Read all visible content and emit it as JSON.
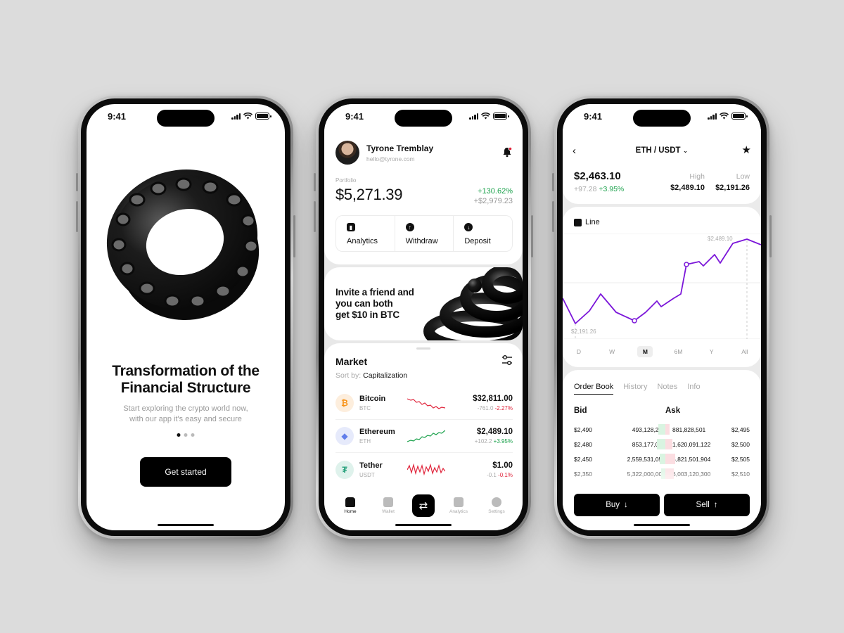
{
  "status_time": "9:41",
  "onboarding": {
    "title_line1": "Transformation of the",
    "title_line2": "Financial Structure",
    "subtitle_line1": "Start exploring the crypto world now,",
    "subtitle_line2": "with our app it's easy and secure",
    "cta_label": "Get started",
    "page_indicator": {
      "count": 3,
      "active": 1
    }
  },
  "home": {
    "user": {
      "name": "Tyrone Tremblay",
      "email": "hello@tyrone.com"
    },
    "portfolio": {
      "label": "Portfolio",
      "value": "$5,271.39",
      "change_pct": "+130.62%",
      "change_abs": "+$2,979.23"
    },
    "actions": [
      {
        "label": "Analytics",
        "icon": "bar-chart-icon"
      },
      {
        "label": "Withdraw",
        "icon": "arrow-up-circle-icon"
      },
      {
        "label": "Deposit",
        "icon": "arrow-down-circle-icon"
      }
    ],
    "promo": {
      "line1": "Invite a friend and",
      "line2": "you can both",
      "line3": "get $10 in BTC"
    },
    "market": {
      "title": "Market",
      "sort_label": "Sort by:",
      "sort_value": "Capitalization",
      "coins": [
        {
          "name": "Bitcoin",
          "symbol": "BTC",
          "price": "$32,811.00",
          "change_abs": "-761.0",
          "change_pct": "-2.27%",
          "trend": "down",
          "icon_color": "#f7931a",
          "icon_bg": "#fdeedd",
          "glyph": "₿"
        },
        {
          "name": "Ethereum",
          "symbol": "ETH",
          "price": "$2,489.10",
          "change_abs": "+102.2",
          "change_pct": "+3.95%",
          "trend": "up",
          "icon_color": "#627eea",
          "icon_bg": "#e6eafb",
          "glyph": "◆"
        },
        {
          "name": "Tether",
          "symbol": "USDT",
          "price": "$1.00",
          "change_abs": "-0.1",
          "change_pct": "-0.1%",
          "trend": "flat",
          "icon_color": "#26a17b",
          "icon_bg": "#dff2ec",
          "glyph": "₮"
        }
      ]
    },
    "tabs": [
      {
        "label": "Home",
        "active": true
      },
      {
        "label": "Wallet",
        "active": false
      },
      {
        "label": "",
        "swap": true
      },
      {
        "label": "Analytics",
        "active": false
      },
      {
        "label": "Settings",
        "active": false
      }
    ]
  },
  "trade": {
    "pair": "ETH / USDT",
    "price": "$2,463.10",
    "change_abs": "+97.28",
    "change_pct": "+3.95%",
    "high_label": "High",
    "high_value": "$2,489.10",
    "low_label": "Low",
    "low_value": "$2,191.26",
    "chart_type_label": "Line",
    "chart_max_label": "$2,489.10",
    "chart_min_label": "$2,191.26",
    "ranges": [
      "D",
      "W",
      "M",
      "6M",
      "Y",
      "All"
    ],
    "active_range": "M",
    "order_tabs": [
      "Order Book",
      "History",
      "Notes",
      "Info"
    ],
    "bid_label": "Bid",
    "ask_label": "Ask",
    "order_rows": [
      {
        "bid_price": "$2,490",
        "bid_qty": "493,128,201",
        "ask_qty": "881,828,501",
        "ask_price": "$2,495"
      },
      {
        "bid_price": "$2,480",
        "bid_qty": "853,177,018",
        "ask_qty": "1,620,091,122",
        "ask_price": "$2,500"
      },
      {
        "bid_price": "$2,450",
        "bid_qty": "2,559,531,054",
        "ask_qty": "5,821,501,904",
        "ask_price": "$2,505"
      },
      {
        "bid_price": "$2,350",
        "bid_qty": "5,322,000,001",
        "ask_qty": "6,003,120,300",
        "ask_price": "$2,510"
      }
    ],
    "buy_label": "Buy",
    "sell_label": "Sell",
    "accent": "#7b16d9"
  },
  "colors": {
    "positive": "#1aa14b",
    "negative": "#e0233a"
  }
}
